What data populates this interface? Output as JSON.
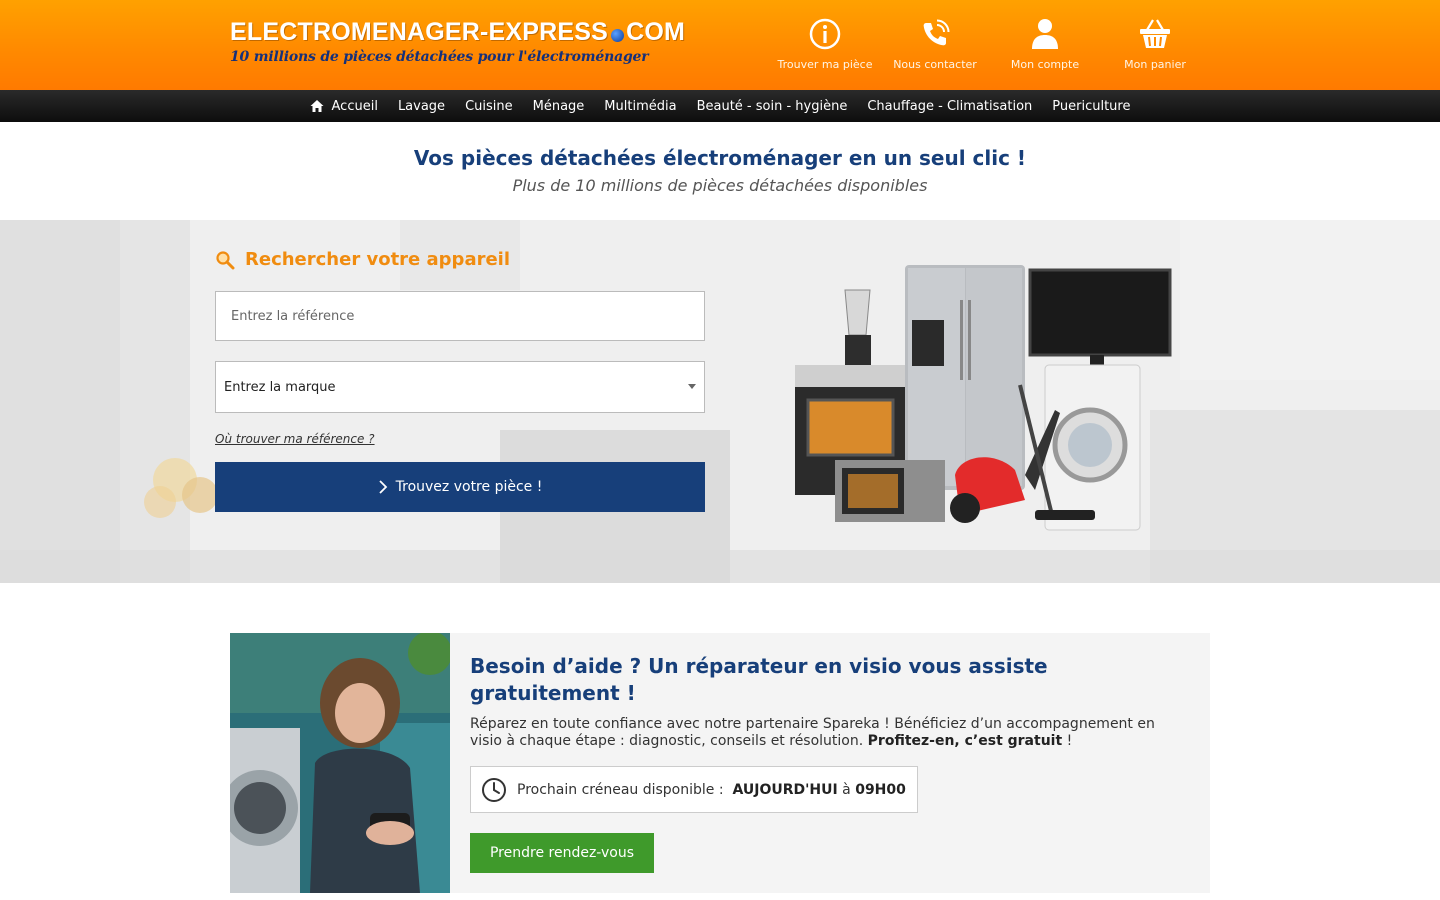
{
  "header": {
    "logo_main_left": "ELECTROMENAGER-EXPRESS",
    "logo_main_right": "COM",
    "tagline": "10 millions de pièces détachées pour l'électroménager",
    "actions": [
      {
        "label": "Trouver ma pièce",
        "icon": "info-icon"
      },
      {
        "label": "Nous contacter",
        "icon": "phone-icon"
      },
      {
        "label": "Mon compte",
        "icon": "user-icon"
      },
      {
        "label": "Mon panier",
        "icon": "basket-icon"
      }
    ]
  },
  "nav": {
    "items": [
      "Accueil",
      "Lavage",
      "Cuisine",
      "Ménage",
      "Multimédia",
      "Beauté - soin - hygiène",
      "Chauffage - Climatisation",
      "Puericulture"
    ]
  },
  "hero": {
    "headline": "Vos pièces détachées électroménager en un seul clic !",
    "subline": "Plus de 10 millions de pièces détachées disponibles"
  },
  "search": {
    "title": "Rechercher votre appareil",
    "reference_placeholder": "Entrez la référence",
    "reference_value": "",
    "brand_selected": "Entrez la marque",
    "help_link": "Où trouver ma référence ?",
    "button_label": "Trouvez votre pièce !"
  },
  "help": {
    "title": "Besoin d’aide ? Un réparateur en visio vous assiste gratuitement !",
    "text": "Réparez en toute confiance avec notre partenaire Spareka ! Bénéficiez d’un accompagnement en visio à chaque étape : diagnostic, conseils et résolution.",
    "text_bold": "Profitez-en, c’est gratuit",
    "text_end": " !",
    "slot_label": "Prochain créneau disponible :",
    "slot_day": "AUJOURD'HUI",
    "slot_at": "à",
    "slot_time": "09H00",
    "button_label": "Prendre rendez-vous"
  },
  "colors": {
    "header_orange": "#ff8a00",
    "brand_blue": "#173f7a",
    "accent_orange": "#f08c10",
    "cta_green": "#3f9a2b",
    "nav_black": "#111111"
  }
}
